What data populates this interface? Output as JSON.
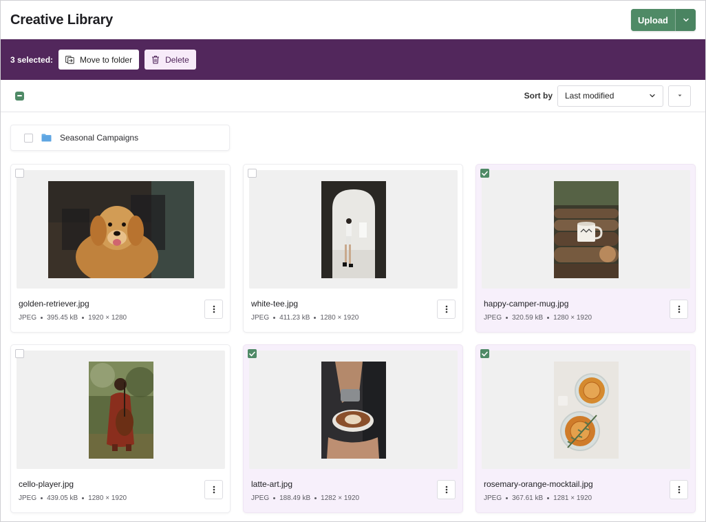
{
  "header": {
    "title": "Creative Library",
    "upload_label": "Upload",
    "accent": "#4f8a66"
  },
  "selection_bar": {
    "count_label": "3 selected:",
    "move_label": "Move to folder",
    "delete_label": "Delete",
    "background": "#52275c"
  },
  "toolbar": {
    "sort_label": "Sort by",
    "sort_value": "Last modified"
  },
  "folders": [
    {
      "name": "Seasonal Campaigns",
      "icon": "folder-icon"
    }
  ],
  "files": [
    {
      "name": "golden-retriever.jpg",
      "type": "JPEG",
      "size": "395.45 kB",
      "dims": "1920 × 1280",
      "selected": false,
      "orientation": "landscape",
      "subject": "dog"
    },
    {
      "name": "white-tee.jpg",
      "type": "JPEG",
      "size": "411.23 kB",
      "dims": "1280 × 1920",
      "selected": false,
      "orientation": "portrait",
      "subject": "arch"
    },
    {
      "name": "happy-camper-mug.jpg",
      "type": "JPEG",
      "size": "320.59 kB",
      "dims": "1280 × 1920",
      "selected": true,
      "orientation": "portrait",
      "subject": "mug"
    },
    {
      "name": "cello-player.jpg",
      "type": "JPEG",
      "size": "439.05 kB",
      "dims": "1280 × 1920",
      "selected": false,
      "orientation": "portrait",
      "subject": "cello"
    },
    {
      "name": "latte-art.jpg",
      "type": "JPEG",
      "size": "188.49 kB",
      "dims": "1282 × 1920",
      "selected": true,
      "orientation": "portrait",
      "subject": "latte"
    },
    {
      "name": "rosemary-orange-mocktail.jpg",
      "type": "JPEG",
      "size": "367.61 kB",
      "dims": "1281 × 1920",
      "selected": true,
      "orientation": "portrait",
      "subject": "mocktail"
    }
  ]
}
